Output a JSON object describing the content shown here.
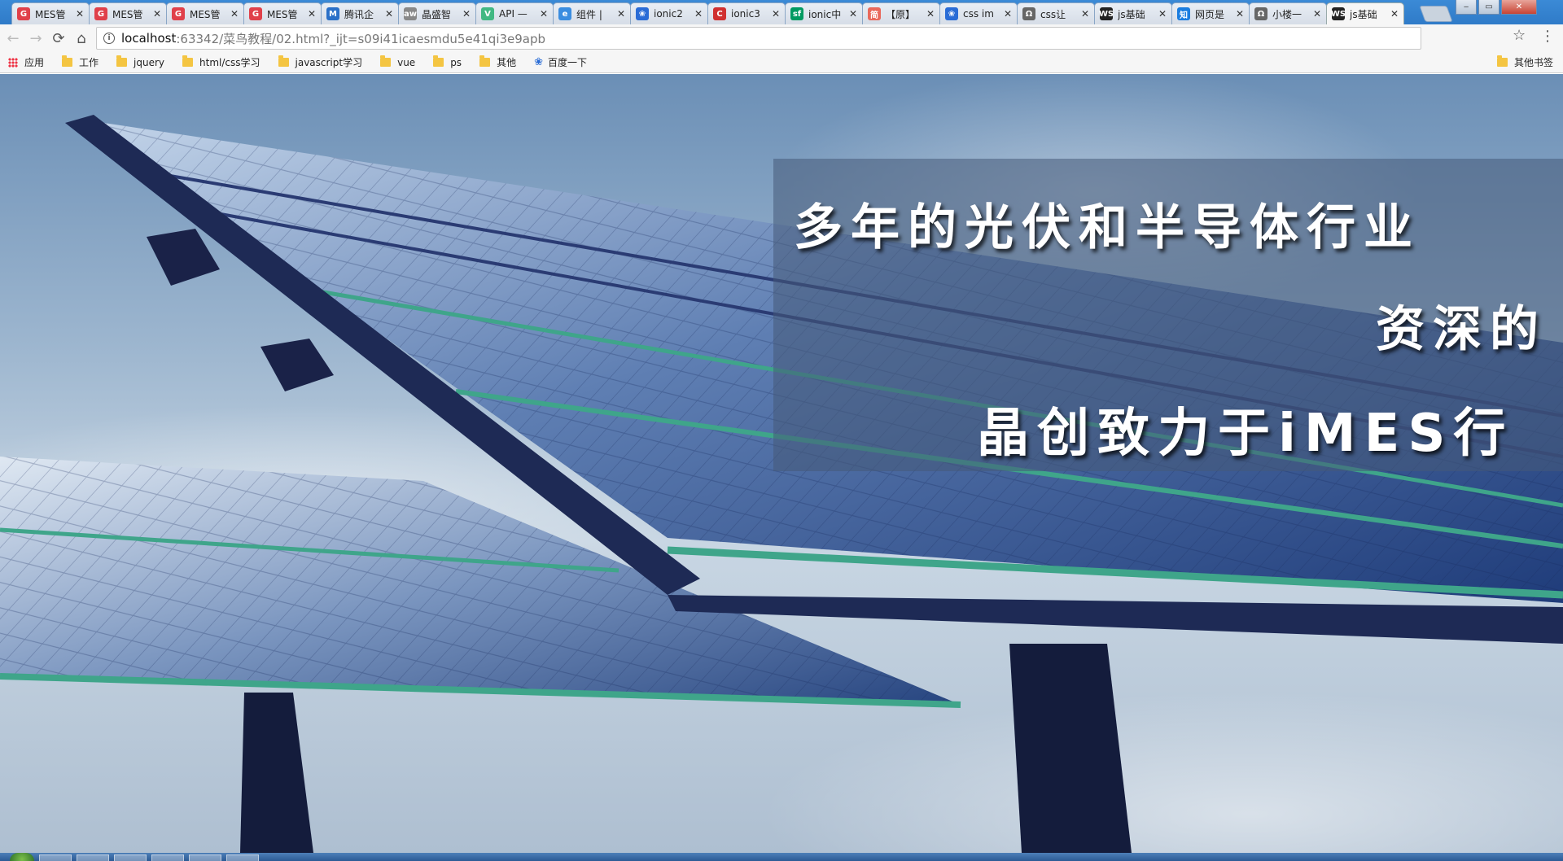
{
  "tabs": [
    {
      "title": "MES管",
      "favicon": "c-red-swirl",
      "color": "#e0404a"
    },
    {
      "title": "MES管",
      "favicon": "c-red-swirl",
      "color": "#e0404a"
    },
    {
      "title": "MES管",
      "favicon": "c-red-swirl",
      "color": "#e0404a"
    },
    {
      "title": "MES管",
      "favicon": "c-red-swirl",
      "color": "#e0404a"
    },
    {
      "title": "腾讯企",
      "favicon": "qq-mail-icon",
      "color": "#2a70c8"
    },
    {
      "title": "晶盛智",
      "favicon": "text-icon",
      "color": "#888888"
    },
    {
      "title": "API —",
      "favicon": "vue-icon",
      "color": "#41b883"
    },
    {
      "title": "组件 |",
      "favicon": "e-icon",
      "color": "#3a8de0"
    },
    {
      "title": "ionic2",
      "favicon": "paw-icon",
      "color": "#2a6cd6"
    },
    {
      "title": "ionic3",
      "favicon": "c-icon",
      "color": "#d03030"
    },
    {
      "title": "ionic中",
      "favicon": "sf-icon",
      "color": "#009a61"
    },
    {
      "title": "【原】",
      "favicon": "jian-icon",
      "color": "#e9685b"
    },
    {
      "title": "css im",
      "favicon": "paw-icon",
      "color": "#2a6cd6"
    },
    {
      "title": "css让",
      "favicon": "q-icon",
      "color": "#666666"
    },
    {
      "title": "js基础",
      "favicon": "ws-icon",
      "color": "#222222"
    },
    {
      "title": "网页是",
      "favicon": "zhi-icon",
      "color": "#1a7de0"
    },
    {
      "title": "小楼一",
      "favicon": "q-icon",
      "color": "#666666"
    },
    {
      "title": "js基础",
      "favicon": "ws-icon",
      "color": "#222222",
      "active": true
    }
  ],
  "toolbar": {
    "back": "←",
    "forward": "→",
    "reload": "⟳",
    "home": "⌂",
    "url_host": "localhost",
    "url_rest": ":63342/菜鸟教程/02.html?_ijt=s09i41icaesmdu5e41qi3e9apb",
    "star": "☆",
    "menu": "⋮",
    "info": "i"
  },
  "bookmarks": {
    "items": [
      "应用",
      "工作",
      "jquery",
      "html/css学习",
      "javascript学习",
      "vue",
      "ps",
      "其他",
      "百度一下"
    ],
    "other": "其他书签"
  },
  "page": {
    "line1": "多年的光伏和半导体行业",
    "line2": "资深的",
    "line3": "晶创致力于iMES行"
  },
  "colors": {
    "tabstrip": "#3b8ad6",
    "overlay": "#465a78",
    "panel_frame": "#1e2a55",
    "panel_stripe": "#3fa58a"
  }
}
